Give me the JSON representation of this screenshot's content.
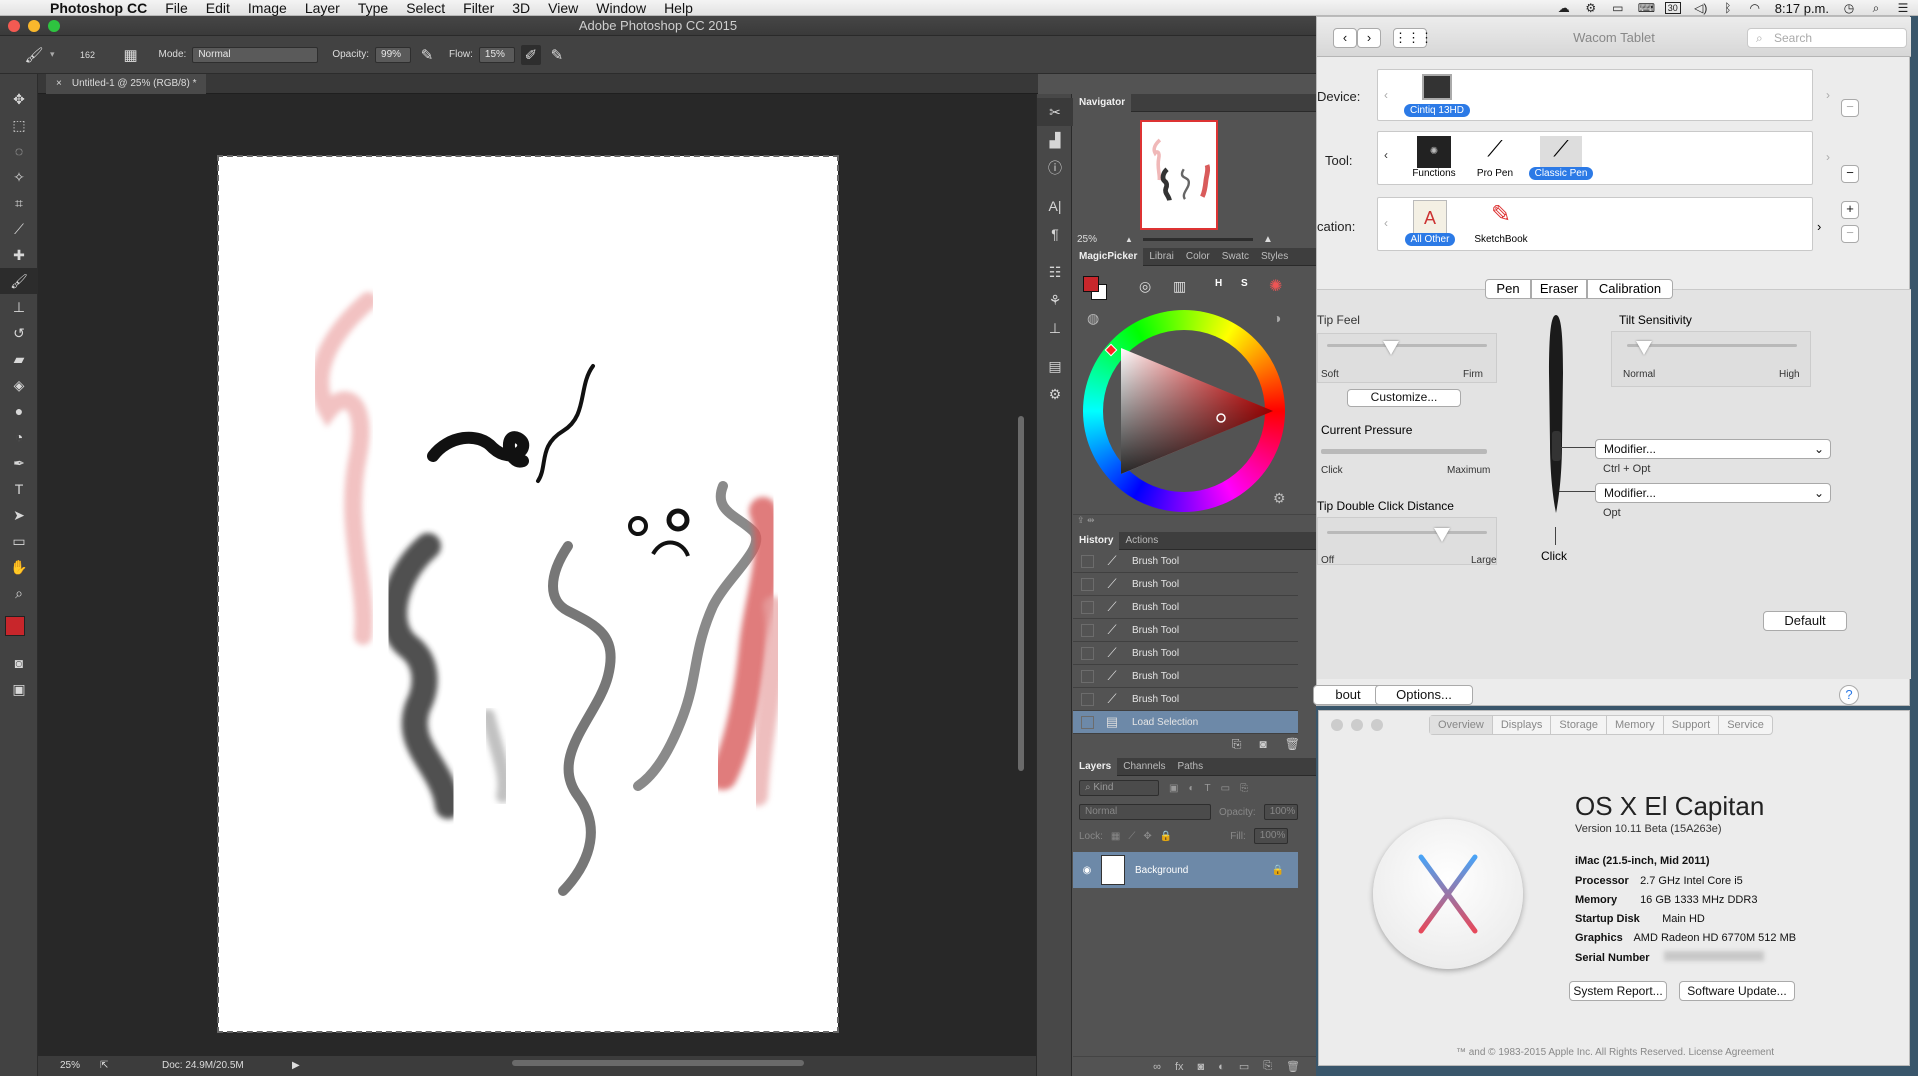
{
  "menubar": {
    "app_name": "Photoshop CC",
    "items": [
      "File",
      "Edit",
      "Image",
      "Layer",
      "Type",
      "Select",
      "Filter",
      "3D",
      "View",
      "Window",
      "Help"
    ],
    "calendar": "30",
    "time": "8:17 p.m."
  },
  "photoshop": {
    "window_title": "Adobe Photoshop CC 2015",
    "options": {
      "brush_size": "162",
      "mode_label": "Mode:",
      "mode_value": "Normal",
      "opacity_label": "Opacity:",
      "opacity_value": "99%",
      "flow_label": "Flow:",
      "flow_value": "15%"
    },
    "doc_tab": "Untitled-1 @ 25% (RGB/8) *",
    "status_zoom": "25%",
    "status_doc": "Doc: 24.9M/20.5M",
    "navigator": {
      "title": "Navigator",
      "zoom": "25%"
    },
    "color_tabs": [
      "MagicPicker",
      "Librai",
      "Color",
      "Swatc",
      "Styles"
    ],
    "magic_buttons": {
      "h": "H",
      "s": "S"
    },
    "history_tabs": [
      "History",
      "Actions"
    ],
    "history_items": [
      "Brush Tool",
      "Brush Tool",
      "Brush Tool",
      "Brush Tool",
      "Brush Tool",
      "Brush Tool",
      "Brush Tool",
      "Load Selection"
    ],
    "layers_tabs": [
      "Layers",
      "Channels",
      "Paths"
    ],
    "layers": {
      "kind": "Kind",
      "blend": "Normal",
      "opacity_label": "Opacity:",
      "opacity_value": "100%",
      "lock_label": "Lock:",
      "fill_label": "Fill:",
      "fill_value": "100%",
      "layer_name": "Background"
    },
    "primary_color": "#c8262b",
    "secondary_color": "#ffffff"
  },
  "wacom": {
    "title": "Wacom Tablet",
    "search_placeholder": "Search",
    "device_label": "Device:",
    "device_name": "Cintiq 13HD",
    "tool_label": "Tool:",
    "tools": [
      "Functions",
      "Pro Pen",
      "Classic Pen"
    ],
    "application_label": "cation:",
    "apps": [
      "All Other",
      "SketchBook"
    ],
    "tabs": [
      "Pen",
      "Eraser",
      "Calibration"
    ],
    "tip_feel": {
      "title": "Tip Feel",
      "min": "Soft",
      "max": "Firm",
      "level": 0.4
    },
    "customize": "Customize...",
    "current_pressure": {
      "title": "Current Pressure",
      "min": "Click",
      "max": "Maximum"
    },
    "double_click": {
      "title": "Tip Double Click Distance",
      "min": "Off",
      "max": "Large",
      "level": 0.72
    },
    "tilt": {
      "title": "Tilt Sensitivity",
      "min": "Normal",
      "max": "High",
      "level": 0.1
    },
    "modifier1": "Modifier...",
    "modifier1_desc": "Ctrl + Opt",
    "modifier2": "Modifier...",
    "modifier2_desc": "Opt",
    "pen_click": "Click",
    "default_btn": "Default",
    "about_btn": "bout",
    "options_btn": "Options...",
    "help": "?"
  },
  "about": {
    "tabs": [
      "Overview",
      "Displays",
      "Storage",
      "Memory",
      "Support",
      "Service"
    ],
    "os_name": "OS X El Capitan",
    "version": "Version 10.11 Beta (15A263e)",
    "model": "iMac (21.5-inch, Mid 2011)",
    "specs": [
      {
        "label": "Processor",
        "value": "2.7 GHz Intel Core i5"
      },
      {
        "label": "Memory",
        "value": "16 GB 1333 MHz DDR3"
      },
      {
        "label": "Startup Disk",
        "value": "Main HD"
      },
      {
        "label": "Graphics",
        "value": "AMD Radeon HD 6770M 512 MB"
      },
      {
        "label": "Serial Number",
        "value": ""
      }
    ],
    "system_report": "System Report...",
    "software_update": "Software Update...",
    "footer": "™ and © 1983-2015 Apple Inc. All Rights Reserved. License Agreement"
  }
}
